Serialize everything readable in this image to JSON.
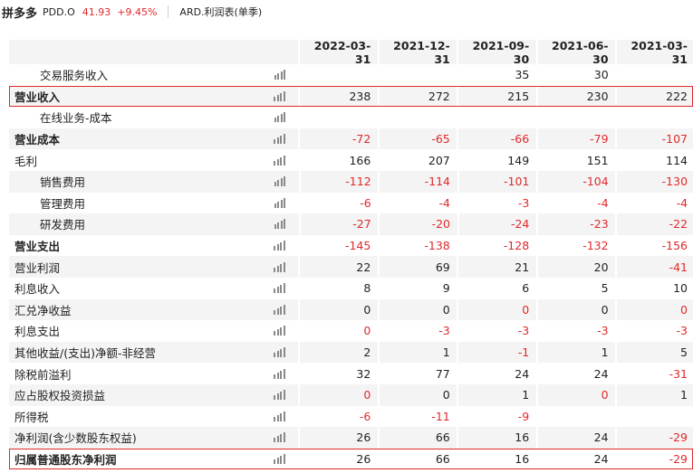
{
  "header": {
    "name": "拼多多",
    "code": "PDD.O",
    "price": "41.93",
    "change": "+9.45%",
    "report": "ARD.利润表(单季)"
  },
  "columns": [
    "2022-03-31",
    "2021-12-31",
    "2021-09-30",
    "2021-06-30",
    "2021-03-31"
  ],
  "rows": [
    {
      "label": "交易服务收入",
      "indent": true,
      "bold": false,
      "values": [
        "",
        "",
        "35",
        "30",
        ""
      ]
    },
    {
      "label": "营业收入",
      "indent": false,
      "bold": true,
      "highlight": true,
      "values": [
        "238",
        "272",
        "215",
        "230",
        "222"
      ]
    },
    {
      "label": "在线业务-成本",
      "indent": true,
      "bold": false,
      "values": [
        "",
        "",
        "",
        "",
        ""
      ]
    },
    {
      "label": "营业成本",
      "indent": false,
      "bold": true,
      "values": [
        "-72",
        "-65",
        "-66",
        "-79",
        "-107"
      ]
    },
    {
      "label": "毛利",
      "indent": false,
      "bold": false,
      "values": [
        "166",
        "207",
        "149",
        "151",
        "114"
      ]
    },
    {
      "label": "销售费用",
      "indent": true,
      "bold": false,
      "values": [
        "-112",
        "-114",
        "-101",
        "-104",
        "-130"
      ]
    },
    {
      "label": "管理费用",
      "indent": true,
      "bold": false,
      "values": [
        "-6",
        "-4",
        "-3",
        "-4",
        "-4"
      ]
    },
    {
      "label": "研发费用",
      "indent": true,
      "bold": false,
      "values": [
        "-27",
        "-20",
        "-24",
        "-23",
        "-22"
      ]
    },
    {
      "label": "营业支出",
      "indent": false,
      "bold": true,
      "values": [
        "-145",
        "-138",
        "-128",
        "-132",
        "-156"
      ]
    },
    {
      "label": "营业利润",
      "indent": false,
      "bold": false,
      "values": [
        "22",
        "69",
        "21",
        "20",
        "-41"
      ]
    },
    {
      "label": "利息收入",
      "indent": false,
      "bold": false,
      "values": [
        "8",
        "9",
        "6",
        "5",
        "10"
      ]
    },
    {
      "label": "汇兑净收益",
      "indent": false,
      "bold": false,
      "values": [
        "0",
        "0",
        "0",
        "0",
        "0"
      ],
      "red": [
        false,
        false,
        true,
        false,
        true
      ]
    },
    {
      "label": "利息支出",
      "indent": false,
      "bold": false,
      "values": [
        "0",
        "-3",
        "-3",
        "-3",
        "-3"
      ],
      "red": [
        true,
        true,
        true,
        true,
        true
      ]
    },
    {
      "label": "其他收益/(支出)净额-非经营",
      "indent": false,
      "bold": false,
      "values": [
        "2",
        "1",
        "-1",
        "1",
        "5"
      ]
    },
    {
      "label": "除税前溢利",
      "indent": false,
      "bold": false,
      "values": [
        "32",
        "77",
        "24",
        "24",
        "-31"
      ]
    },
    {
      "label": "应占股权投资损益",
      "indent": false,
      "bold": false,
      "values": [
        "0",
        "0",
        "1",
        "0",
        "1"
      ],
      "red": [
        true,
        false,
        false,
        true,
        false
      ]
    },
    {
      "label": "所得税",
      "indent": false,
      "bold": false,
      "values": [
        "-6",
        "-11",
        "-9",
        "",
        ""
      ]
    },
    {
      "label": "净利润(含少数股东权益)",
      "indent": false,
      "bold": false,
      "values": [
        "26",
        "66",
        "16",
        "24",
        "-29"
      ]
    },
    {
      "label": "归属普通股东净利润",
      "indent": false,
      "bold": true,
      "highlight": true,
      "values": [
        "26",
        "66",
        "16",
        "24",
        "-29"
      ]
    }
  ],
  "colors": {
    "accent": "#e0292b"
  }
}
